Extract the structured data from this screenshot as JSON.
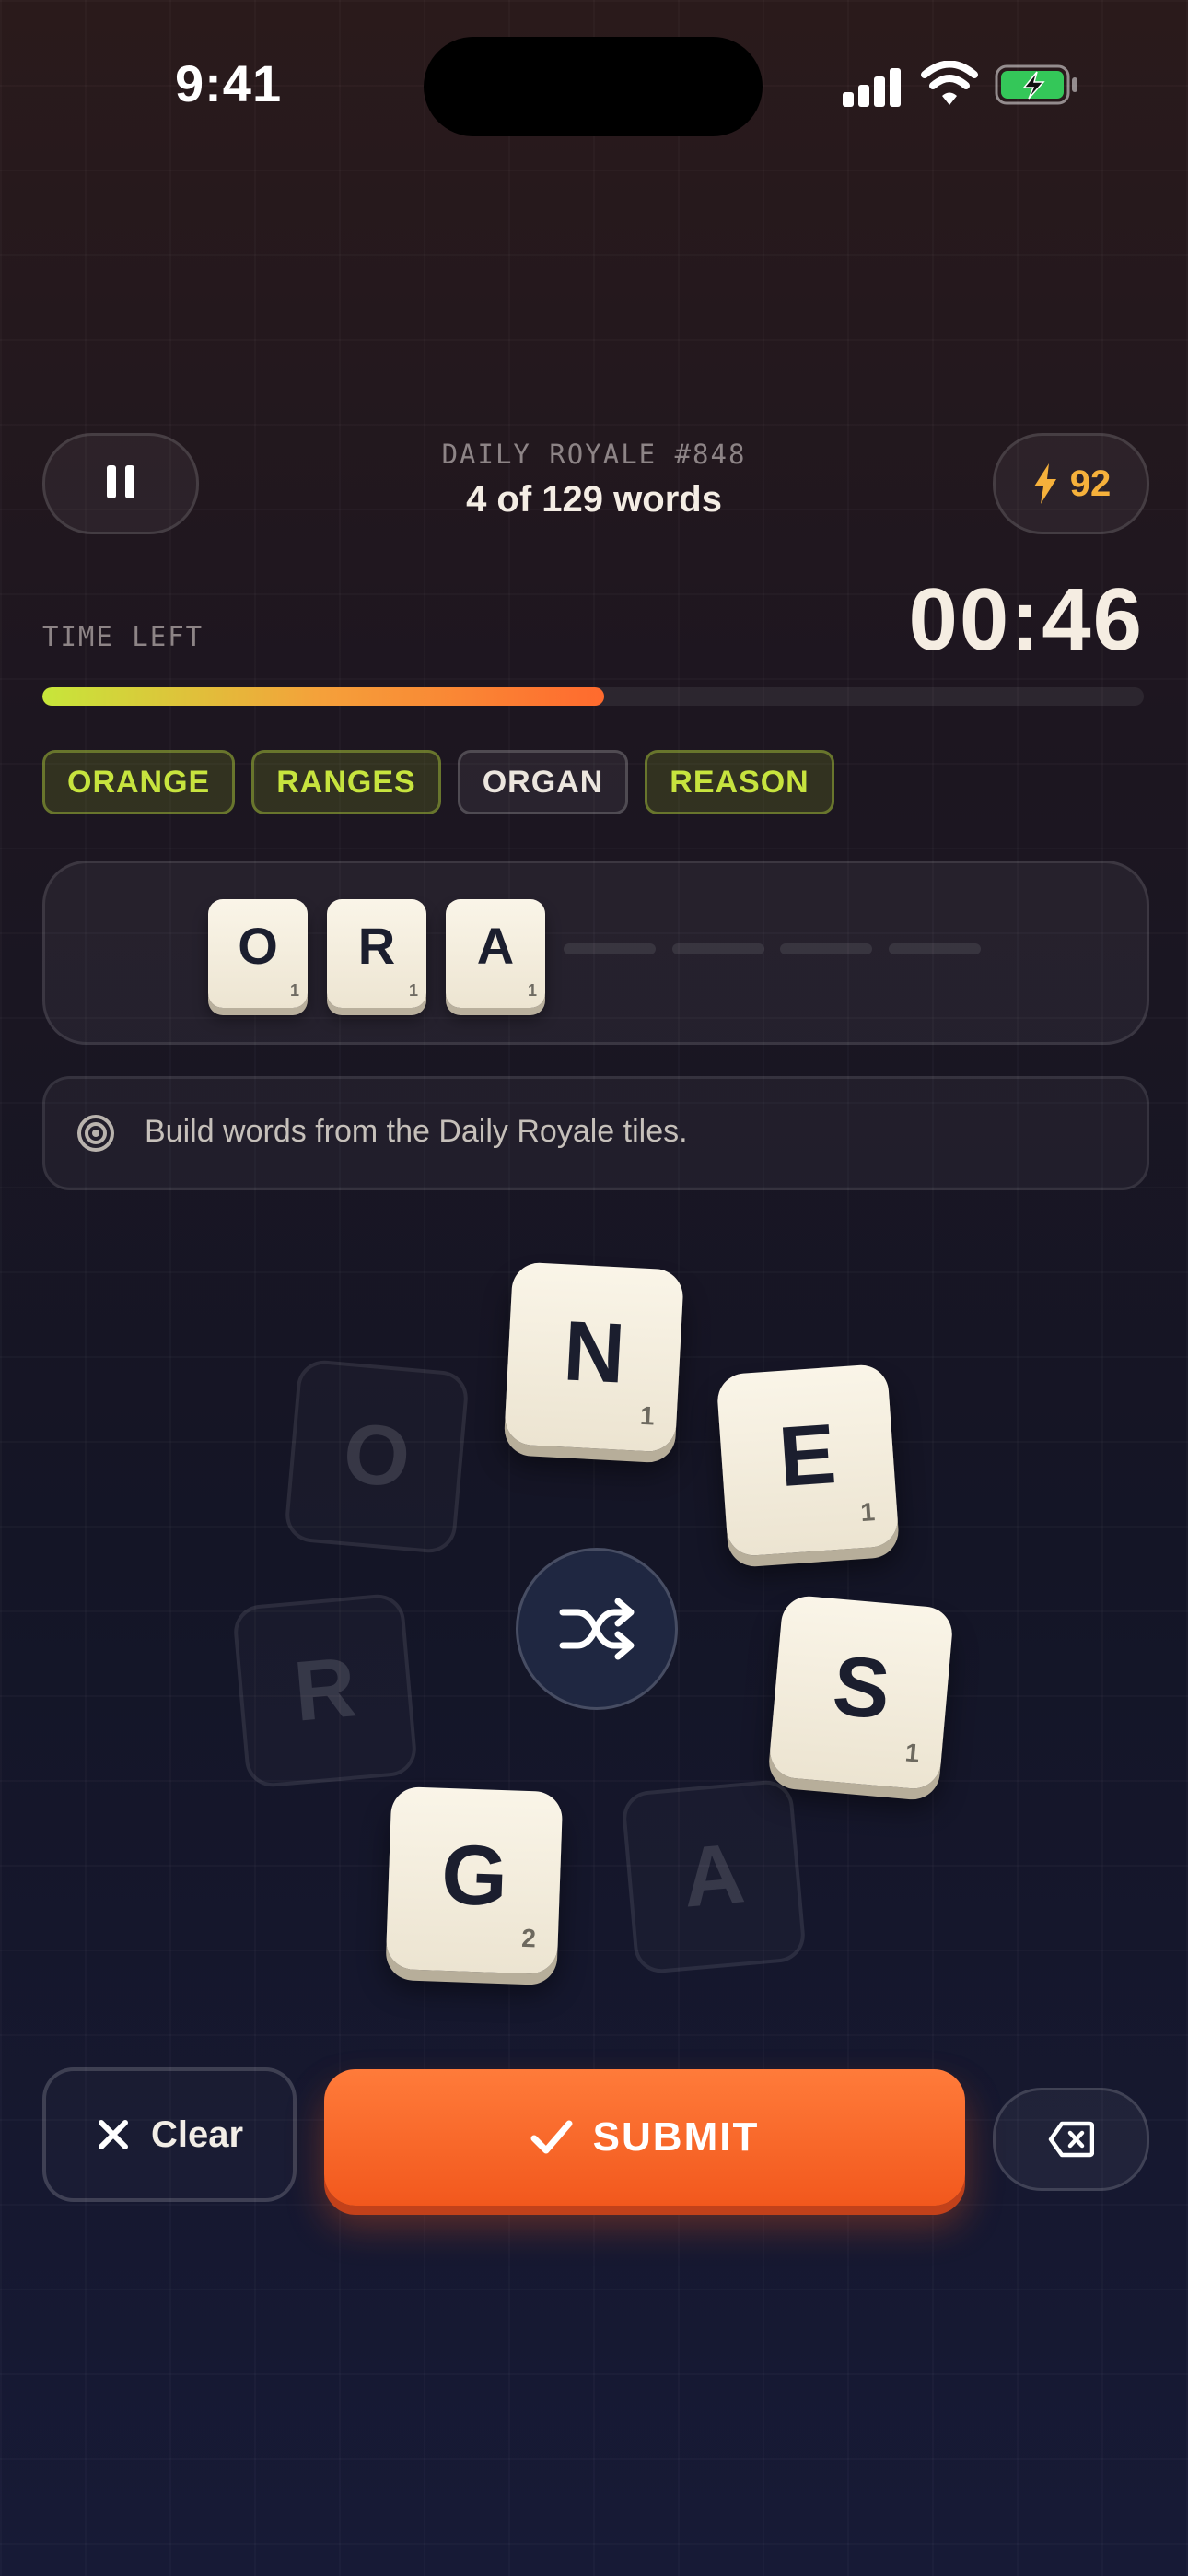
{
  "status_bar": {
    "time": "9:41"
  },
  "header": {
    "subtitle": "DAILY ROYALE #848",
    "title": "4 of 129 words",
    "energy": "92",
    "energy_icon": "lightning-icon",
    "pause_icon": "pause-icon"
  },
  "timer": {
    "label": "TIME LEFT",
    "value": "00:46",
    "progress": 0.51
  },
  "found_words": [
    "ORANGE",
    "RANGES",
    "ORGAN",
    "REASON"
  ],
  "current_word": {
    "tiles": [
      {
        "letter": "O",
        "points": "1"
      },
      {
        "letter": "R",
        "points": "1"
      },
      {
        "letter": "A",
        "points": "1"
      }
    ]
  },
  "hint": {
    "text": "Build words from the Daily Royale tiles.",
    "icon": "target-icon"
  },
  "wheel": {
    "tiles": [
      {
        "letter": "N",
        "points": "1",
        "state": "available"
      },
      {
        "letter": "E",
        "points": "1",
        "state": "available"
      },
      {
        "letter": "S",
        "points": "1",
        "state": "available"
      },
      {
        "letter": "A",
        "points": "",
        "state": "used"
      },
      {
        "letter": "G",
        "points": "2",
        "state": "available"
      },
      {
        "letter": "R",
        "points": "",
        "state": "used"
      },
      {
        "letter": "O",
        "points": "",
        "state": "used"
      }
    ],
    "shuffle_icon": "shuffle-icon"
  },
  "controls": {
    "clear_label": "Clear",
    "submit_label": "SUBMIT",
    "backspace_icon": "backspace-icon"
  },
  "colors": {
    "accent": "#ff6a2e",
    "found_word": "#c7e43e",
    "energy": "#f6b13b"
  }
}
